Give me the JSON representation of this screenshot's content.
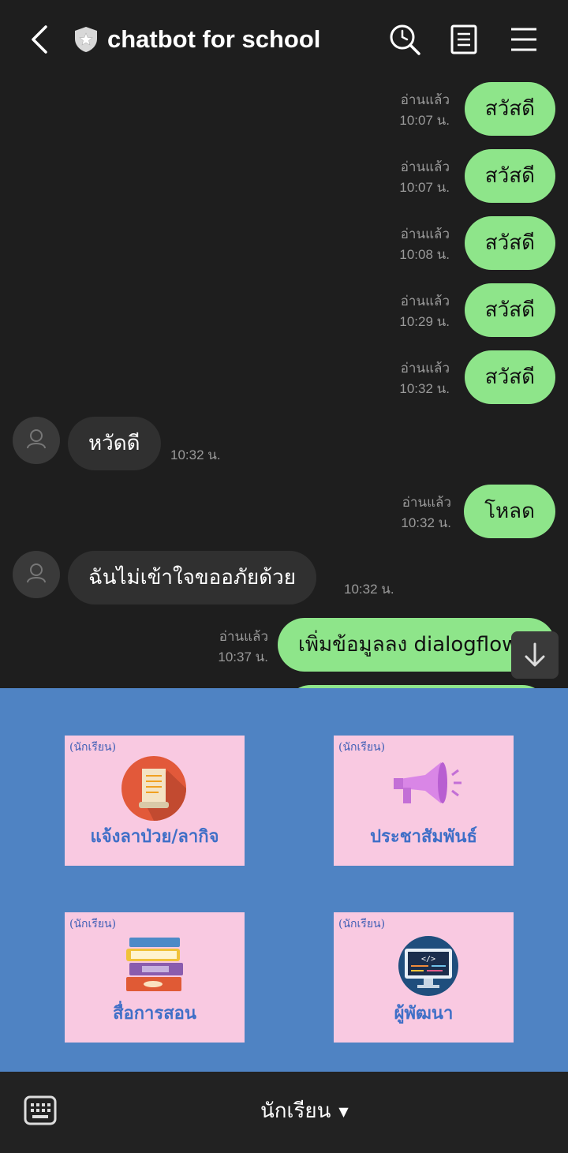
{
  "header": {
    "title": "chatbot for school"
  },
  "messages": [
    {
      "dir": "out",
      "text": "สวัสดี",
      "read": "อ่านแล้ว",
      "time": "10:07 น."
    },
    {
      "dir": "out",
      "text": "สวัสดี",
      "read": "อ่านแล้ว",
      "time": "10:07 น."
    },
    {
      "dir": "out",
      "text": "สวัสดี",
      "read": "อ่านแล้ว",
      "time": "10:08 น."
    },
    {
      "dir": "out",
      "text": "สวัสดี",
      "read": "อ่านแล้ว",
      "time": "10:29 น."
    },
    {
      "dir": "out",
      "text": "สวัสดี",
      "read": "อ่านแล้ว",
      "time": "10:32 น."
    },
    {
      "dir": "in",
      "text": "หวัดดี",
      "time": "10:32 น."
    },
    {
      "dir": "out",
      "text": "โหลด",
      "read": "อ่านแล้ว",
      "time": "10:32 น."
    },
    {
      "dir": "in",
      "text": "ฉันไม่เข้าใจขออภัยด้วย",
      "time": "10:32 น."
    },
    {
      "dir": "out",
      "text": "เพิ่มข้อมูลลง dialogflow",
      "read": "อ่านแล้ว",
      "time": "10:37 น."
    }
  ],
  "rich_menu": {
    "cards": [
      {
        "tag": "(นักเรียน)",
        "label": "แจ้งลาป่วย/ลากิจ",
        "icon": "document-icon"
      },
      {
        "tag": "(นักเรียน)",
        "label": "ประชาสัมพันธ์",
        "icon": "megaphone-icon"
      },
      {
        "tag": "(นักเรียน)",
        "label": "สื่อการสอน",
        "icon": "books-icon"
      },
      {
        "tag": "(นักเรียน)",
        "label": "ผู้พัฒนา",
        "icon": "code-monitor-icon"
      }
    ]
  },
  "bottom": {
    "menu_label": "นักเรียน",
    "caret": "▼"
  },
  "colors": {
    "outgoing_bubble": "#8ee58a",
    "incoming_bubble": "#303030",
    "menu_bg": "#4f83c3",
    "card_bg": "#f9c9e1"
  }
}
